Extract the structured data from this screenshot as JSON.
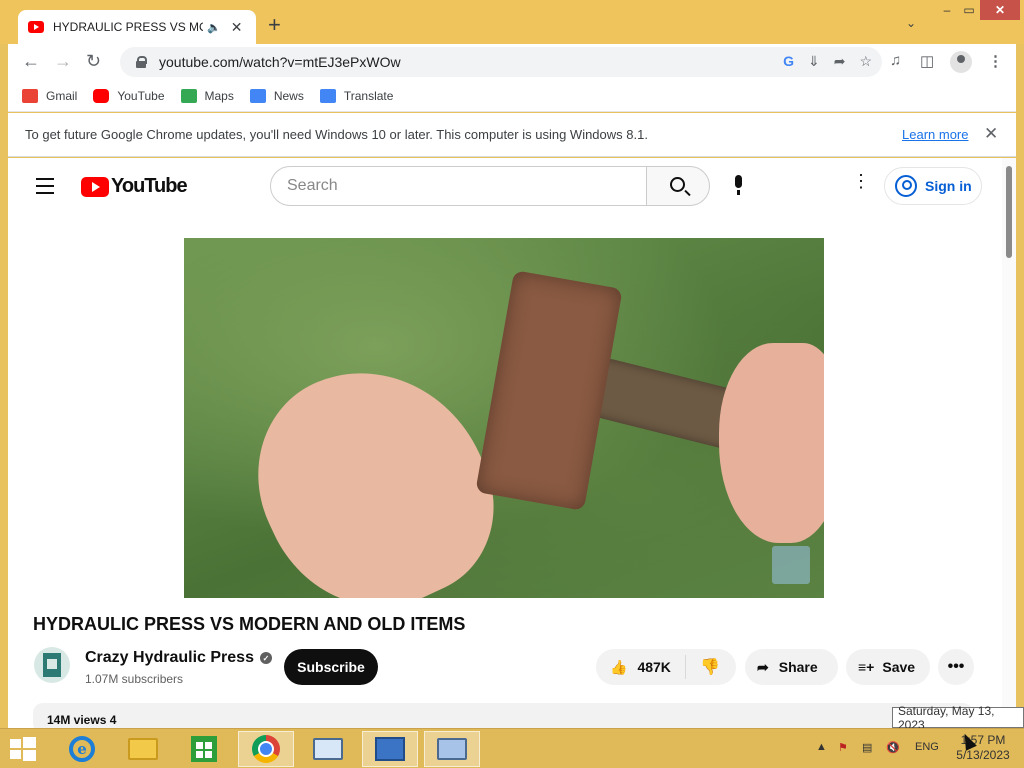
{
  "browser": {
    "tab": {
      "title": "HYDRAULIC PRESS VS MODE",
      "audio_icon": "speaker-icon",
      "close_glyph": "✕"
    },
    "new_tab_glyph": "+",
    "tab_search_glyph": "⌄",
    "window_controls": {
      "minimize": "–",
      "maximize": "▭",
      "close": "✕"
    },
    "nav": {
      "back": "←",
      "forward": "→",
      "reload": "↻"
    },
    "url": "youtube.com/watch?v=mtEJ3ePxWOw",
    "omnibox_icons": [
      "google-lens-icon",
      "install-icon",
      "share-icon",
      "bookmark-star-icon"
    ],
    "bookmarks": [
      {
        "label": "Gmail",
        "icon": "gmail-icon",
        "color": "#ea4335"
      },
      {
        "label": "YouTube",
        "icon": "youtube-icon",
        "color": "#ff0000"
      },
      {
        "label": "Maps",
        "icon": "maps-icon",
        "color": "#34a853"
      },
      {
        "label": "News",
        "icon": "news-icon",
        "color": "#4285f4"
      },
      {
        "label": "Translate",
        "icon": "translate-icon",
        "color": "#4285f4"
      }
    ],
    "infobar": {
      "message": "To get future Google Chrome updates, you'll need Windows 10 or later. This computer is using Windows 8.1.",
      "link": "Learn more",
      "close": "✕"
    }
  },
  "youtube": {
    "logo_text": "YouTube",
    "search_placeholder": "Search",
    "signin_label": "Sign in",
    "video": {
      "title": "HYDRAULIC PRESS VS MODERN AND OLD ITEMS",
      "channel": "Crazy Hydraulic Press",
      "verified": "✓",
      "subscribers": "1.07M subscribers",
      "subscribe_label": "Subscribe",
      "likes": "487K",
      "share_label": "Share",
      "save_label": "Save",
      "more_glyph": "•••",
      "description_preview": "14M views  4"
    }
  },
  "tooltip": "Saturday, May 13, 2023",
  "taskbar": {
    "apps": [
      "internet-explorer-icon",
      "file-explorer-icon",
      "store-icon",
      "chrome-icon",
      "desktop-icon",
      "remote-desktop-icon",
      "keyboard-settings-icon"
    ],
    "language": "ENG",
    "time": "1:57 PM",
    "date": "5/13/2023"
  },
  "colors": {
    "window_frame": "#efc45c",
    "youtube_red": "#ff0000",
    "link_blue": "#1a73e8",
    "signin_blue": "#065fd4"
  }
}
